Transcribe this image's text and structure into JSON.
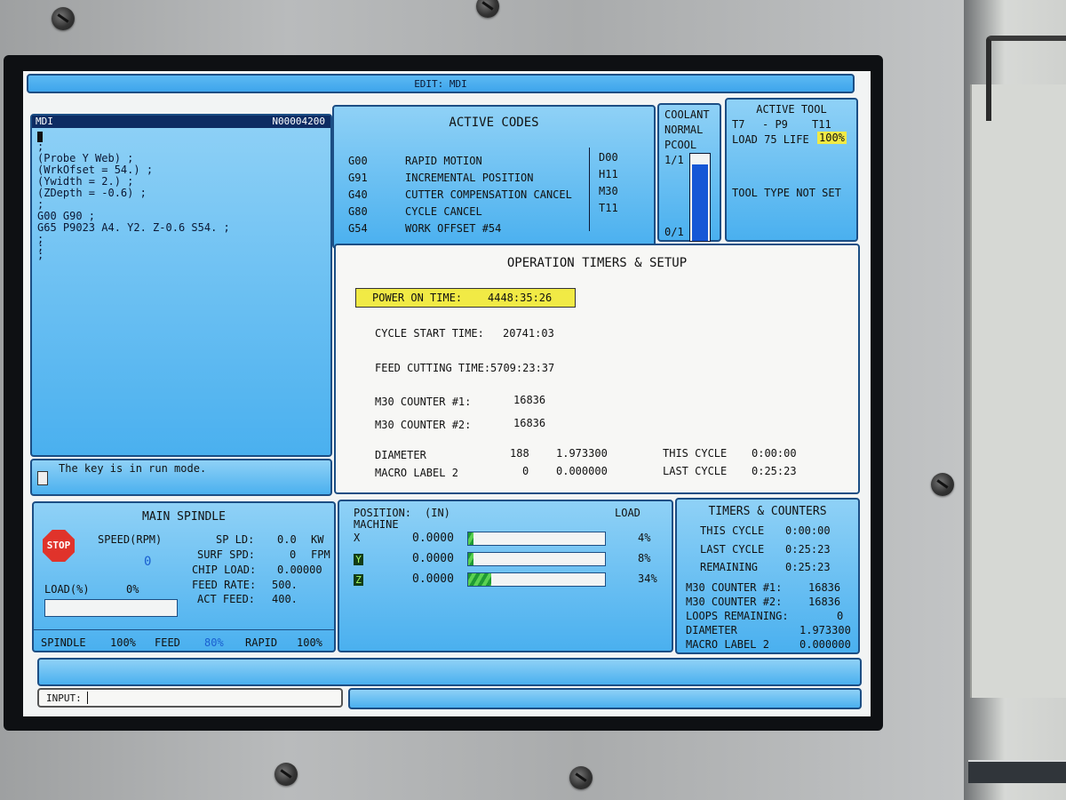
{
  "header": {
    "title": "EDIT: MDI"
  },
  "mdi": {
    "label": "MDI",
    "program_number": "N00004200",
    "lines": [
      ";",
      "(Probe Y Web) ;",
      "(WrkOfset = 54.) ;",
      "(Ywidth = 2.) ;",
      "(ZDepth = -0.6) ;",
      ";",
      "G00 G90 ;",
      "G65 P9023 A4. Y2. Z-0.6 S54. ;",
      ";",
      ";",
      ";"
    ],
    "status_message": "The key is in run mode."
  },
  "active_codes": {
    "title": "ACTIVE CODES",
    "codes": [
      {
        "code": "G00",
        "desc": "RAPID MOTION"
      },
      {
        "code": "G91",
        "desc": "INCREMENTAL POSITION"
      },
      {
        "code": "G40",
        "desc": "CUTTER COMPENSATION CANCEL"
      },
      {
        "code": "G80",
        "desc": "CYCLE CANCEL"
      },
      {
        "code": "G54",
        "desc": "WORK OFFSET #54"
      }
    ],
    "side_codes": [
      "D00",
      "H11",
      "M30",
      "T11"
    ]
  },
  "coolant": {
    "title": "COOLANT",
    "state": "NORMAL",
    "pcool_label": "PCOOL",
    "top_label": "1/1",
    "bottom_label": "0/1",
    "level_fraction": 0.88
  },
  "active_tool": {
    "title": "ACTIVE TOOL",
    "tool": "T7",
    "pocket": "- P9",
    "next_tool": "T11",
    "load_text": "LOAD 75 LIFE",
    "life_value": "100%",
    "tool_type": "TOOL TYPE NOT SET"
  },
  "timers": {
    "title": "OPERATION TIMERS & SETUP",
    "power_on_label": "POWER ON TIME:",
    "power_on_value": "4448:35:26",
    "cycle_start_label": "CYCLE START TIME:",
    "cycle_start_value": "20741:03",
    "feed_cutting_label": "FEED CUTTING TIME:",
    "feed_cutting_value": "5709:23:37",
    "m30_1_label": "M30 COUNTER #1:",
    "m30_1_value": "16836",
    "m30_2_label": "M30 COUNTER #2:",
    "m30_2_value": "16836",
    "diameter_label": "DIAMETER",
    "diameter_index": "188",
    "diameter_value": "1.973300",
    "macro_label": "MACRO LABEL 2",
    "macro_index": "0",
    "macro_value": "0.000000",
    "this_cycle_label": "THIS CYCLE",
    "this_cycle_value": "0:00:00",
    "last_cycle_label": "LAST CYCLE",
    "last_cycle_value": "0:25:23"
  },
  "spindle": {
    "title": "MAIN SPINDLE",
    "stop_label": "STOP",
    "speed_label": "SPEED(RPM)",
    "speed_value": "0",
    "sp_ld_label": "SP LD:",
    "sp_ld_value": "0.0",
    "sp_ld_unit": "KW",
    "surf_spd_label": "SURF SPD:",
    "surf_spd_value": "0",
    "surf_spd_unit": "FPM",
    "chip_load_label": "CHIP LOAD:",
    "chip_load_value": "0.00000",
    "feed_rate_label": "FEED RATE:",
    "feed_rate_value": "500.",
    "act_feed_label": "ACT FEED:",
    "act_feed_value": "400.",
    "load_label": "LOAD(%)",
    "load_value": "0%",
    "spindle_override_label": "SPINDLE",
    "spindle_override_value": "100%",
    "feed_override_label": "FEED",
    "feed_override_value": "80%",
    "rapid_override_label": "RAPID",
    "rapid_override_value": "100%"
  },
  "position": {
    "title": "POSITION:",
    "units": "(IN)",
    "mode": "MACHINE",
    "load_header": "LOAD",
    "axes": [
      {
        "name": "X",
        "value": "0.0000",
        "load": "4%",
        "load_fraction": 0.04
      },
      {
        "name": "Y",
        "value": "0.0000",
        "load": "8%",
        "load_fraction": 0.04
      },
      {
        "name": "Z",
        "value": "0.0000",
        "load": "34%",
        "load_fraction": 0.17
      }
    ]
  },
  "counters": {
    "title": "TIMERS & COUNTERS",
    "this_cycle_label": "THIS CYCLE",
    "this_cycle_value": "0:00:00",
    "last_cycle_label": "LAST CYCLE",
    "last_cycle_value": "0:25:23",
    "remaining_label": "REMAINING",
    "remaining_value": "0:25:23",
    "m30_1_label": "M30 COUNTER #1:",
    "m30_1_value": "16836",
    "m30_2_label": "M30 COUNTER #2:",
    "m30_2_value": "16836",
    "loops_label": "LOOPS REMAINING:",
    "loops_value": "0",
    "diameter_label": "DIAMETER",
    "diameter_value": "1.973300",
    "macro_label": "MACRO LABEL 2",
    "macro_value": "0.000000"
  },
  "input": {
    "label": "INPUT:"
  },
  "colors": {
    "panel_blue": "#4ab0ef",
    "panel_border": "#1c4e84",
    "highlight_yellow": "#f1ea45",
    "coolant_fill": "#1657d6",
    "stop_red": "#e0332b",
    "feed_override_blue": "#1a5fd0",
    "load_bar_green": "#1f9a33"
  }
}
